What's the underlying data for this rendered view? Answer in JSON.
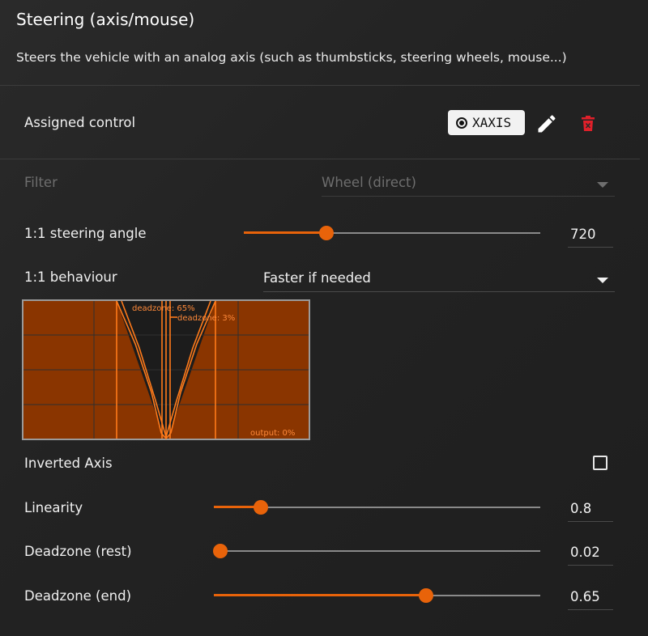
{
  "header": {
    "title": "Steering (axis/mouse)",
    "description": "Steers the vehicle with an analog axis (such as thumbsticks, steering wheels, mouse...)"
  },
  "assigned": {
    "label": "Assigned control",
    "control": "XAXIS",
    "control_icon": "radio-target-icon",
    "edit_icon": "pencil-icon",
    "delete_icon": "trash-icon",
    "delete_color": "#e0202a"
  },
  "filter": {
    "label": "Filter",
    "value": "Wheel (direct)",
    "disabled": true
  },
  "steering_angle": {
    "label": "1:1 steering angle",
    "value": "720",
    "fraction": 0.28
  },
  "behaviour": {
    "label": "1:1 behaviour",
    "value": "Faster if needed"
  },
  "graph": {
    "deadzone_end_label": "deadzone: 65%",
    "deadzone_rest_label": "deadzone: 3%",
    "output_label": "output: 0%",
    "fill_color": "#8a3500",
    "line_color": "#ff7a1a"
  },
  "inverted": {
    "label": "Inverted Axis",
    "checked": false
  },
  "linearity": {
    "label": "Linearity",
    "value": "0.8",
    "fraction": 0.143
  },
  "deadzone_rest": {
    "label": "Deadzone (rest)",
    "value": "0.02",
    "fraction": 0.02
  },
  "deadzone_end": {
    "label": "Deadzone (end)",
    "value": "0.65",
    "fraction": 0.65
  },
  "colors": {
    "accent": "#e8630a",
    "background": "#232323"
  }
}
